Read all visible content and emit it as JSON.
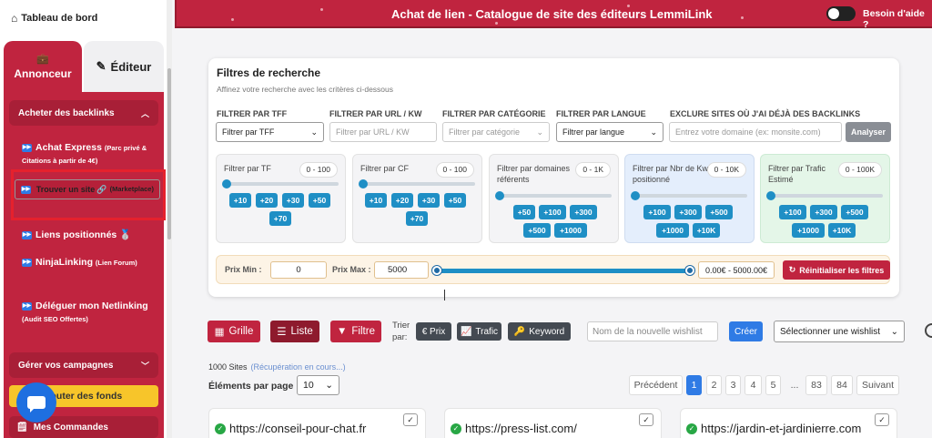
{
  "sidebar": {
    "home_label": "Tableau de bord",
    "tabs": [
      {
        "label": "Annonceur"
      },
      {
        "label": "Éditeur"
      }
    ],
    "section_buy": "Acheter des backlinks",
    "items": [
      {
        "label": "Achat Express",
        "note": "(Parc privé & Citations à partir de 4€)"
      },
      {
        "label": "Trouver un site",
        "note": "(Marketplace)"
      },
      {
        "label": "Liens positionnés",
        "note": ""
      },
      {
        "label": "NinjaLinking",
        "note": "(Lien Forum)"
      },
      {
        "label": "Déléguer mon Netlinking",
        "note": "(Audit SEO Offertes)"
      }
    ],
    "section_campaigns": "Gérer vos campagnes",
    "funds_label": "Ajouter des fonds",
    "orders_label": "Mes Commandes"
  },
  "header": {
    "title": "Achat de lien - Catalogue de site des éditeurs LemmiLink",
    "help_label": "Besoin d'aide ?"
  },
  "filters": {
    "title": "Filtres de recherche",
    "subtitle": "Affinez votre recherche avec les critères ci-dessous",
    "tff": {
      "label": "FILTRER PAR TFF",
      "value": "Filtrer par TFF"
    },
    "url": {
      "label": "FILTRER PAR URL / KW",
      "placeholder": "Filtrer par URL / KW"
    },
    "category": {
      "label": "FILTRER PAR CATÉGORIE",
      "placeholder": "Filtrer par catégorie"
    },
    "language": {
      "label": "FILTRER PAR LANGUE",
      "value": "Filtrer par langue"
    },
    "exclude": {
      "label": "EXCLURE SITES OÙ J'AI DÉJÀ DES BACKLINKS",
      "placeholder": "Entrez votre domaine (ex: monsite.com)",
      "button": "Analyser"
    },
    "boxes": [
      {
        "title": "Filtrer par TF",
        "range": "0 - 100",
        "chips": [
          "+10",
          "+20",
          "+30",
          "+50",
          "+70"
        ]
      },
      {
        "title": "Filtrer par CF",
        "range": "0 - 100",
        "chips": [
          "+10",
          "+20",
          "+30",
          "+50",
          "+70"
        ]
      },
      {
        "title": "Filtrer par domaines référents",
        "range": "0 - 1K",
        "chips": [
          "+50",
          "+100",
          "+300",
          "+500",
          "+1000"
        ]
      },
      {
        "title": "Filtrer par Nbr de Kw positionné",
        "range": "0 - 10K",
        "chips": [
          "+100",
          "+300",
          "+500",
          "+1000",
          "+10K"
        ]
      },
      {
        "title": "Filtrer par Trafic Estimé",
        "range": "0 - 100K",
        "chips": [
          "+100",
          "+300",
          "+500",
          "+1000",
          "+10K"
        ]
      }
    ],
    "price": {
      "min_label": "Prix Min :",
      "min_value": "0",
      "max_label": "Prix Max :",
      "max_value": "5000",
      "range_text": "0.00€ - 5000.00€",
      "reset_label": "Réinitialiser les filtres"
    }
  },
  "toolbar": {
    "grid_label": "Grille",
    "list_label": "Liste",
    "filter_label": "Filtre",
    "sort_label": "Trier par:",
    "sort_buttons": [
      "€ Prix",
      "Trafic",
      "Keyword"
    ],
    "wishlist_placeholder": "Nom de la nouvelle wishlist",
    "create_label": "Créer",
    "wishlist_select": "Sélectionner une wishlist"
  },
  "results": {
    "count": "1000 Sites",
    "status": "(Récupération en cours...)",
    "per_page_label": "Éléments par page :",
    "per_page_value": "10"
  },
  "pagination": {
    "prev": "Précédent",
    "pages": [
      "1",
      "2",
      "3",
      "4",
      "5",
      "...",
      "83",
      "84"
    ],
    "next": "Suivant",
    "current": "1"
  },
  "sites": [
    "https://conseil-pour-chat.fr",
    "https://press-list.com/",
    "https://jardin-et-jardinierre.com"
  ],
  "colors": {
    "brand": "#c0243f",
    "accent": "#1f8fc5",
    "blue": "#2f7be5"
  }
}
